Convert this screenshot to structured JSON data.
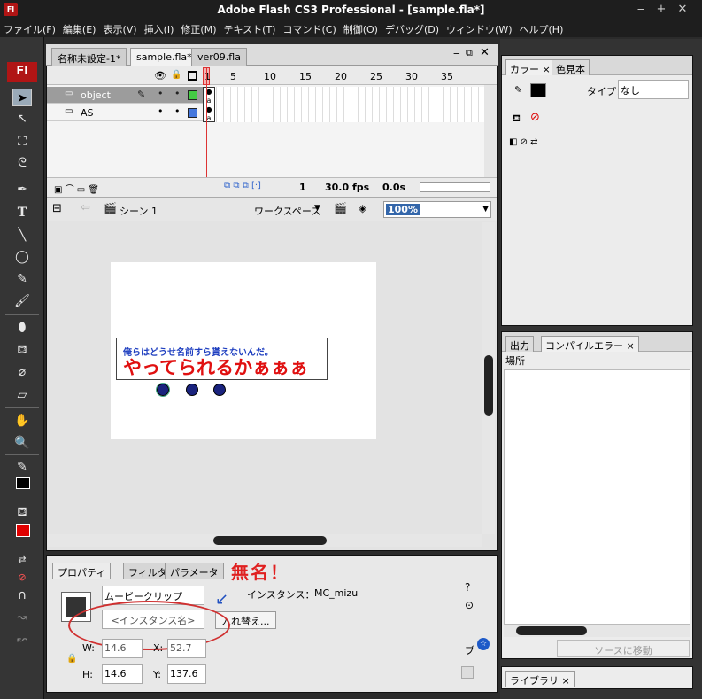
{
  "window": {
    "title": "Adobe Flash CS3 Professional - [sample.fla*]",
    "app_icon": "Fl",
    "minimize": "‒",
    "maximize": "+",
    "close": "✕"
  },
  "menu": [
    "ファイル(F)",
    "編集(E)",
    "表示(V)",
    "挿入(I)",
    "修正(M)",
    "テキスト(T)",
    "コマンド(C)",
    "制御(O)",
    "デバッグ(D)",
    "ウィンドウ(W)",
    "ヘルプ(H)"
  ],
  "tools": {
    "logo": "Fl"
  },
  "doc_tabs": [
    "名称未設定-1*",
    "sample.fla*",
    "ver09.fla"
  ],
  "timeline": {
    "layers": [
      {
        "name": "object",
        "color": "#44cc44"
      },
      {
        "name": "AS",
        "color": "#4477dd"
      }
    ],
    "ruler": [
      "1",
      "5",
      "10",
      "15",
      "20",
      "25",
      "30",
      "35"
    ],
    "status": {
      "frame": "1",
      "fps": "30.0 fps",
      "time": "0.0s"
    }
  },
  "editbar": {
    "scene": "シーン 1",
    "workspace": "ワークスペース",
    "zoom": "100%"
  },
  "stage": {
    "text_small": "俺らはどうせ名前すら貰えないんだ。",
    "text_big": "やってられるかぁぁぁ"
  },
  "annotation": {
    "text": "無名！",
    "color": "#e02020"
  },
  "properties": {
    "tabs": [
      "プロパティ",
      "フィルタ",
      "パラメータ"
    ],
    "symbol_type": "ムービークリップ",
    "instance_label": "インスタンス：",
    "instance_value": "MC_mizu",
    "instance_name_placeholder": "<インスタンス名>",
    "swap_button": "入れ替え...",
    "w_label": "W:",
    "w_value": "14.6",
    "h_label": "H:",
    "h_value": "14.6",
    "x_label": "X:",
    "x_value": "52.7",
    "y_label": "Y:",
    "y_value": "137.6",
    "blend_label": "ブ"
  },
  "color_panel": {
    "tabs": [
      "カラー",
      "色見本"
    ],
    "type_label": "タイプ：",
    "type_value": "なし"
  },
  "output_panel": {
    "tabs": [
      "出力",
      "コンパイルエラー"
    ],
    "column": "場所",
    "goto_button": "ソースに移動"
  },
  "library_panel": {
    "tab": "ライブラリ"
  }
}
